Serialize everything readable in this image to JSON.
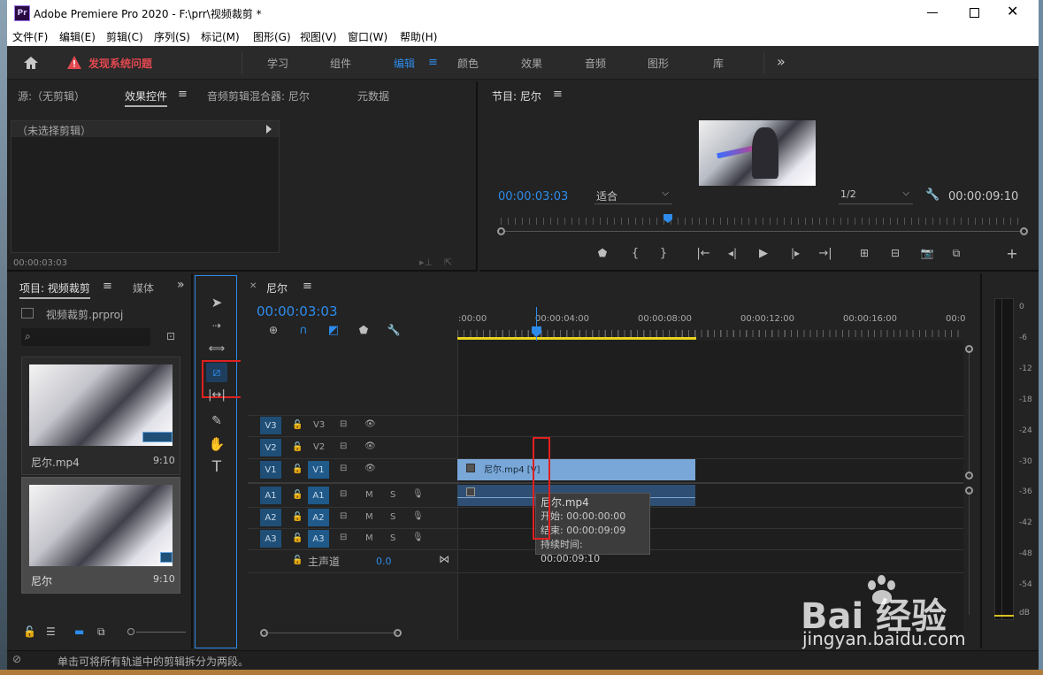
{
  "app": {
    "title": "Adobe Premiere Pro 2020 - F:\\prr\\视频裁剪 *",
    "logo": "Pr"
  },
  "menu": [
    "文件(F)",
    "编辑(E)",
    "剪辑(C)",
    "序列(S)",
    "标记(M)",
    "图形(G)",
    "视图(V)",
    "窗口(W)",
    "帮助(H)"
  ],
  "workspace": {
    "warning": "发现系统问题",
    "tabs": [
      "学习",
      "组件",
      "编辑",
      "颜色",
      "效果",
      "音频",
      "图形",
      "库"
    ],
    "active": "编辑",
    "more": "»"
  },
  "source_panel": {
    "tabs": [
      "源:（无剪辑）",
      "效果控件",
      "音频剪辑混合器: 尼尔",
      "元数据"
    ],
    "no_clip": "（未选择剪辑）",
    "timecode": "00:00:03:03"
  },
  "program": {
    "title": "节目: 尼尔",
    "timecode": "00:00:03:03",
    "fit": "适合",
    "resolution": "1/2",
    "duration": "00:00:09:10"
  },
  "project": {
    "tabs": [
      "项目: 视频裁剪",
      "媒体"
    ],
    "file": "视频裁剪.prproj",
    "items": [
      {
        "name": "尼尔.mp4",
        "duration": "9:10"
      },
      {
        "name": "尼尔",
        "duration": "9:10"
      }
    ]
  },
  "timeline": {
    "sequence": "尼尔",
    "timecode": "00:00:03:03",
    "ruler": [
      ":00:00",
      "00:00:04:00",
      "00:00:08:00",
      "00:00:12:00",
      "00:00:16:00",
      "00:0"
    ],
    "video_tracks": [
      "V3",
      "V2",
      "V1"
    ],
    "audio_tracks": [
      "A1",
      "A2",
      "A3"
    ],
    "master": {
      "label": "主声道",
      "value": "0.0"
    },
    "video_clip": "尼尔.mp4 [V]",
    "tooltip": {
      "name": "尼尔.mp4",
      "start": "开始: 00:00:00:00",
      "end": "结束: 00:00:09:09",
      "duration": "持续时间: 00:00:09:10"
    },
    "track_buttons": {
      "mute": "M",
      "solo": "S"
    }
  },
  "meter": [
    "0",
    "-6",
    "-12",
    "-18",
    "-24",
    "-30",
    "-36",
    "-42",
    "-48",
    "-54",
    "dB"
  ],
  "status": "单击可将所有轨道中的剪辑拆分为两段。",
  "watermark": {
    "brand": "Bai 经验",
    "url": "jingyan.baidu.com"
  }
}
